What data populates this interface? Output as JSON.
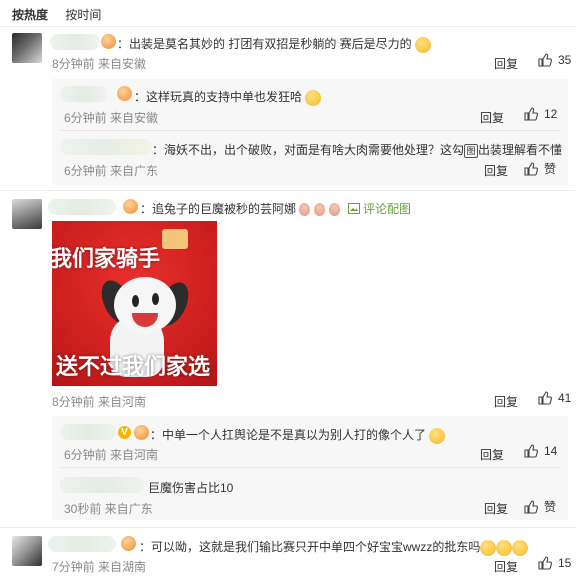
{
  "tabs": {
    "hot": "按热度",
    "time": "按时间"
  },
  "comments": [
    {
      "text": "：出装是莫名其妙的 打团有双招是秒躺的 赛后是尽力的",
      "meta": "8分钟前 来自安徽",
      "reply": "回复",
      "likes": "35",
      "replies": [
        {
          "text": "：这样玩真的支持中单也发狂哈",
          "meta": "6分钟前 来自安徽",
          "reply": "回复",
          "likes": "12"
        },
        {
          "text": "：海妖不出，出个破败，对面是有啥大肉需要他处理？这勾",
          "text_icon": "图",
          "text_tail": "出装理解看不懂",
          "meta": "6分钟前 来自广东",
          "reply": "回复",
          "likes": "赞"
        }
      ]
    },
    {
      "text": "：追兔子的巨魔被秒的芸阿娜",
      "pic_link": "评论配图",
      "image": {
        "top_text": "我们家骑手",
        "bottom_text": "送不过我们家选"
      },
      "meta": "8分钟前 来自河南",
      "reply": "回复",
      "likes": "41",
      "replies": [
        {
          "badge": "V",
          "text": "：中单一个人扛舆论是不是真以为别人打的像个人了",
          "meta": "6分钟前 来自河南",
          "reply": "回复",
          "likes": "14"
        },
        {
          "text": "巨魔伤害占比10",
          "meta": "30秒前 来自广东",
          "reply": "回复",
          "likes": "赞"
        }
      ]
    },
    {
      "text": "：可以呦，这就是我们输比赛只开中单四个好宝宝wwzz的批东吗",
      "meta": "7分钟前 来自湖南",
      "reply": "回复",
      "likes": "15"
    }
  ],
  "colors": {
    "accent_green": "#6a9d3f",
    "meta_gray": "#8a8a8a",
    "ad_red": "#d42424"
  }
}
